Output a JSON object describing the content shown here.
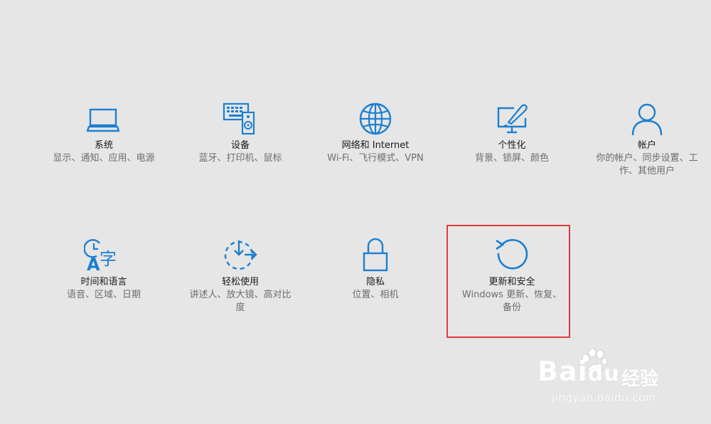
{
  "colors": {
    "accent": "#1c7fd1",
    "background": "#e6e6e6",
    "title": "#1a1a1a",
    "description": "#6d6d6d",
    "highlight": "#e03b3b"
  },
  "tiles": [
    {
      "icon": "laptop-icon",
      "title": "系统",
      "desc": "显示、通知、应用、电源"
    },
    {
      "icon": "devices-icon",
      "title": "设备",
      "desc": "蓝牙、打印机、鼠标"
    },
    {
      "icon": "globe-icon",
      "title": "网络和 Internet",
      "desc": "Wi-Fi、飞行模式、VPN"
    },
    {
      "icon": "personalization-icon",
      "title": "个性化",
      "desc": "背景、锁屏、颜色"
    },
    {
      "icon": "person-icon",
      "title": "帐户",
      "desc": "你的帐户、同步设置、工作、其他用户"
    },
    {
      "icon": "time-language-icon",
      "title": "时间和语言",
      "desc": "语音、区域、日期"
    },
    {
      "icon": "ease-of-access-icon",
      "title": "轻松使用",
      "desc": "讲述人、放大镜、高对比度"
    },
    {
      "icon": "lock-icon",
      "title": "隐私",
      "desc": "位置、相机"
    },
    {
      "icon": "update-icon",
      "title": "更新和安全",
      "desc": "Windows 更新、恢复、备份"
    }
  ],
  "watermark": {
    "logo": "Bai",
    "logo_tail": "du",
    "sub": "经验",
    "url": "jingyan.baidu.com"
  }
}
